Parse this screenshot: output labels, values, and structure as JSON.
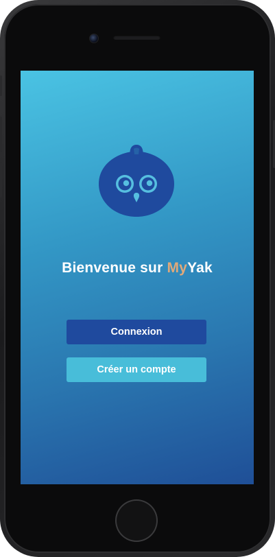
{
  "welcome": {
    "prefix": "Bienvenue sur ",
    "brand_part1": "My",
    "brand_part2": "Yak"
  },
  "buttons": {
    "login_label": "Connexion",
    "register_label": "Créer un compte"
  },
  "colors": {
    "gradient_top": "#4ac3e3",
    "gradient_bottom": "#1f4f97",
    "primary_button": "#1f4a9e",
    "secondary_button": "#48bdd9",
    "brand_accent": "#e0a97a",
    "logo": "#1f4a9e"
  },
  "icons": {
    "logo": "yak-owl-logo-icon"
  }
}
